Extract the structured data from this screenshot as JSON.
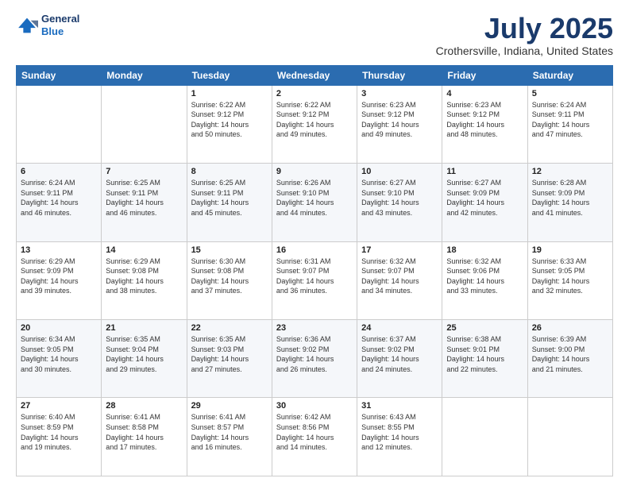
{
  "header": {
    "logo_line1": "General",
    "logo_line2": "Blue",
    "title": "July 2025",
    "subtitle": "Crothersville, Indiana, United States"
  },
  "days_of_week": [
    "Sunday",
    "Monday",
    "Tuesday",
    "Wednesday",
    "Thursday",
    "Friday",
    "Saturday"
  ],
  "weeks": [
    [
      {
        "day": "",
        "info": ""
      },
      {
        "day": "",
        "info": ""
      },
      {
        "day": "1",
        "info": "Sunrise: 6:22 AM\nSunset: 9:12 PM\nDaylight: 14 hours\nand 50 minutes."
      },
      {
        "day": "2",
        "info": "Sunrise: 6:22 AM\nSunset: 9:12 PM\nDaylight: 14 hours\nand 49 minutes."
      },
      {
        "day": "3",
        "info": "Sunrise: 6:23 AM\nSunset: 9:12 PM\nDaylight: 14 hours\nand 49 minutes."
      },
      {
        "day": "4",
        "info": "Sunrise: 6:23 AM\nSunset: 9:12 PM\nDaylight: 14 hours\nand 48 minutes."
      },
      {
        "day": "5",
        "info": "Sunrise: 6:24 AM\nSunset: 9:11 PM\nDaylight: 14 hours\nand 47 minutes."
      }
    ],
    [
      {
        "day": "6",
        "info": "Sunrise: 6:24 AM\nSunset: 9:11 PM\nDaylight: 14 hours\nand 46 minutes."
      },
      {
        "day": "7",
        "info": "Sunrise: 6:25 AM\nSunset: 9:11 PM\nDaylight: 14 hours\nand 46 minutes."
      },
      {
        "day": "8",
        "info": "Sunrise: 6:25 AM\nSunset: 9:11 PM\nDaylight: 14 hours\nand 45 minutes."
      },
      {
        "day": "9",
        "info": "Sunrise: 6:26 AM\nSunset: 9:10 PM\nDaylight: 14 hours\nand 44 minutes."
      },
      {
        "day": "10",
        "info": "Sunrise: 6:27 AM\nSunset: 9:10 PM\nDaylight: 14 hours\nand 43 minutes."
      },
      {
        "day": "11",
        "info": "Sunrise: 6:27 AM\nSunset: 9:09 PM\nDaylight: 14 hours\nand 42 minutes."
      },
      {
        "day": "12",
        "info": "Sunrise: 6:28 AM\nSunset: 9:09 PM\nDaylight: 14 hours\nand 41 minutes."
      }
    ],
    [
      {
        "day": "13",
        "info": "Sunrise: 6:29 AM\nSunset: 9:09 PM\nDaylight: 14 hours\nand 39 minutes."
      },
      {
        "day": "14",
        "info": "Sunrise: 6:29 AM\nSunset: 9:08 PM\nDaylight: 14 hours\nand 38 minutes."
      },
      {
        "day": "15",
        "info": "Sunrise: 6:30 AM\nSunset: 9:08 PM\nDaylight: 14 hours\nand 37 minutes."
      },
      {
        "day": "16",
        "info": "Sunrise: 6:31 AM\nSunset: 9:07 PM\nDaylight: 14 hours\nand 36 minutes."
      },
      {
        "day": "17",
        "info": "Sunrise: 6:32 AM\nSunset: 9:07 PM\nDaylight: 14 hours\nand 34 minutes."
      },
      {
        "day": "18",
        "info": "Sunrise: 6:32 AM\nSunset: 9:06 PM\nDaylight: 14 hours\nand 33 minutes."
      },
      {
        "day": "19",
        "info": "Sunrise: 6:33 AM\nSunset: 9:05 PM\nDaylight: 14 hours\nand 32 minutes."
      }
    ],
    [
      {
        "day": "20",
        "info": "Sunrise: 6:34 AM\nSunset: 9:05 PM\nDaylight: 14 hours\nand 30 minutes."
      },
      {
        "day": "21",
        "info": "Sunrise: 6:35 AM\nSunset: 9:04 PM\nDaylight: 14 hours\nand 29 minutes."
      },
      {
        "day": "22",
        "info": "Sunrise: 6:35 AM\nSunset: 9:03 PM\nDaylight: 14 hours\nand 27 minutes."
      },
      {
        "day": "23",
        "info": "Sunrise: 6:36 AM\nSunset: 9:02 PM\nDaylight: 14 hours\nand 26 minutes."
      },
      {
        "day": "24",
        "info": "Sunrise: 6:37 AM\nSunset: 9:02 PM\nDaylight: 14 hours\nand 24 minutes."
      },
      {
        "day": "25",
        "info": "Sunrise: 6:38 AM\nSunset: 9:01 PM\nDaylight: 14 hours\nand 22 minutes."
      },
      {
        "day": "26",
        "info": "Sunrise: 6:39 AM\nSunset: 9:00 PM\nDaylight: 14 hours\nand 21 minutes."
      }
    ],
    [
      {
        "day": "27",
        "info": "Sunrise: 6:40 AM\nSunset: 8:59 PM\nDaylight: 14 hours\nand 19 minutes."
      },
      {
        "day": "28",
        "info": "Sunrise: 6:41 AM\nSunset: 8:58 PM\nDaylight: 14 hours\nand 17 minutes."
      },
      {
        "day": "29",
        "info": "Sunrise: 6:41 AM\nSunset: 8:57 PM\nDaylight: 14 hours\nand 16 minutes."
      },
      {
        "day": "30",
        "info": "Sunrise: 6:42 AM\nSunset: 8:56 PM\nDaylight: 14 hours\nand 14 minutes."
      },
      {
        "day": "31",
        "info": "Sunrise: 6:43 AM\nSunset: 8:55 PM\nDaylight: 14 hours\nand 12 minutes."
      },
      {
        "day": "",
        "info": ""
      },
      {
        "day": "",
        "info": ""
      }
    ]
  ]
}
